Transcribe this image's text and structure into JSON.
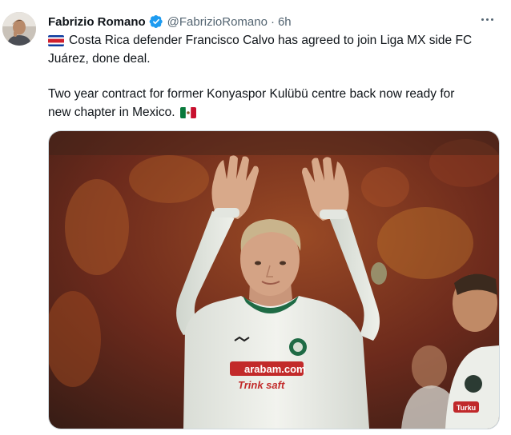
{
  "tweet": {
    "author_name": "Fabrizio Romano",
    "handle": "@FabrizioRomano",
    "separator": "·",
    "time": "6h",
    "verified": true,
    "more_icon": "more-horizontal-icon",
    "lines": [
      "Costa Rica defender Francisco Calvo has agreed to join Liga MX side FC",
      "Juárez, done deal.",
      "Two year contract for former Konyaspor Kulübü centre back now ready for",
      "new chapter in Mexico."
    ],
    "flags": [
      "costa-rica-flag-icon",
      "mexico-flag-icon"
    ],
    "media": {
      "jersey_sponsor_top": "arabam.com",
      "jersey_sponsor_bottom": "Trink saft",
      "background_player_sponsor": "Turku"
    }
  },
  "colors": {
    "text": "#0f1419",
    "secondary": "#536471",
    "verified_blue": "#1d9bf0",
    "border": "#cfd9de",
    "stadium_red": "#8a2f22",
    "stadium_orange": "#c8741f",
    "jersey_white": "#eef0ec",
    "jersey_green": "#1f6b45"
  }
}
